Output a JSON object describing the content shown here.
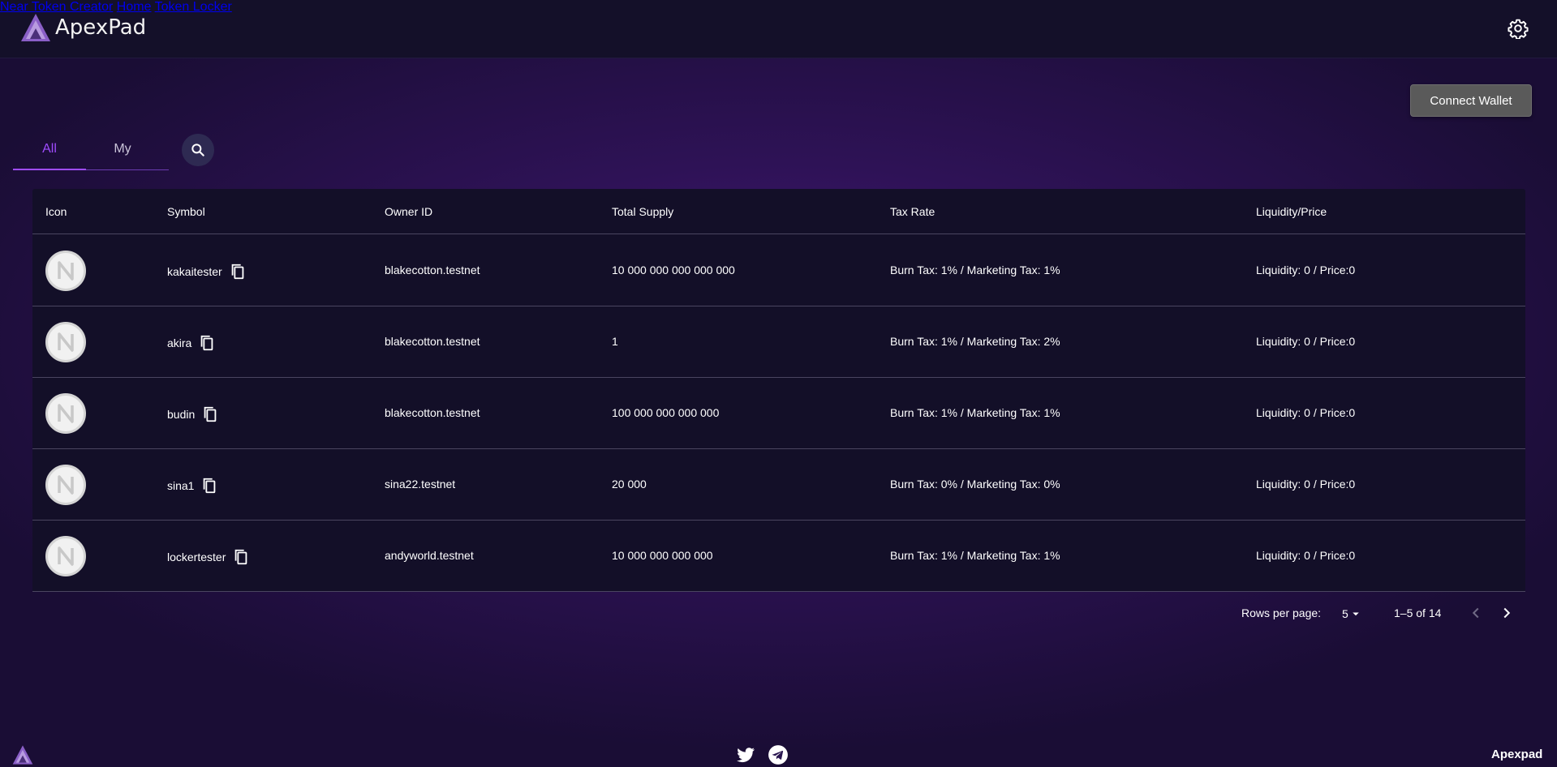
{
  "app": {
    "name": "ApexPad",
    "footer_brand": "Apexpad"
  },
  "nav": [
    {
      "label": "Near Token Creator"
    },
    {
      "label": "Home"
    },
    {
      "label": "Token Locker"
    }
  ],
  "wallet": {
    "connect_label": "Connect Wallet"
  },
  "tabs": [
    {
      "label": "All",
      "active": true
    },
    {
      "label": "My",
      "active": false
    }
  ],
  "table": {
    "headers": {
      "icon": "Icon",
      "symbol": "Symbol",
      "owner": "Owner ID",
      "supply": "Total Supply",
      "tax": "Tax Rate",
      "liquidity": "Liquidity/Price"
    },
    "rows": [
      {
        "symbol": "kakaitester",
        "owner": "blakecotton.testnet",
        "supply": "10 000 000 000 000 000",
        "tax": "Burn Tax: 1% / Marketing Tax: 1%",
        "liquidity": "Liquidity: 0 / Price:0"
      },
      {
        "symbol": "akira",
        "owner": "blakecotton.testnet",
        "supply": "1",
        "tax": "Burn Tax: 1% / Marketing Tax: 2%",
        "liquidity": "Liquidity: 0 / Price:0"
      },
      {
        "symbol": "budin",
        "owner": "blakecotton.testnet",
        "supply": "100 000 000 000 000",
        "tax": "Burn Tax: 1% / Marketing Tax: 1%",
        "liquidity": "Liquidity: 0 / Price:0"
      },
      {
        "symbol": "sina1",
        "owner": "sina22.testnet",
        "supply": "20 000",
        "tax": "Burn Tax: 0% / Marketing Tax: 0%",
        "liquidity": "Liquidity: 0 / Price:0"
      },
      {
        "symbol": "lockertester",
        "owner": "andyworld.testnet",
        "supply": "10 000 000 000 000",
        "tax": "Burn Tax: 1% / Marketing Tax: 1%",
        "liquidity": "Liquidity: 0 / Price:0"
      }
    ]
  },
  "pagination": {
    "rows_per_page_label": "Rows per page:",
    "rows_per_page": "5",
    "range": "1–5 of 14"
  },
  "icons": {
    "logo": "apexpad-logo-icon",
    "settings": "gear-icon",
    "search": "search-icon",
    "token": "near-token-icon",
    "copy": "copy-icon",
    "twitter": "twitter-icon",
    "telegram": "telegram-icon"
  },
  "colors": {
    "accent": "#9f4cff",
    "header_bg": "#141029",
    "table_bg": "#130f28",
    "button_bg": "#5a5a5a"
  }
}
